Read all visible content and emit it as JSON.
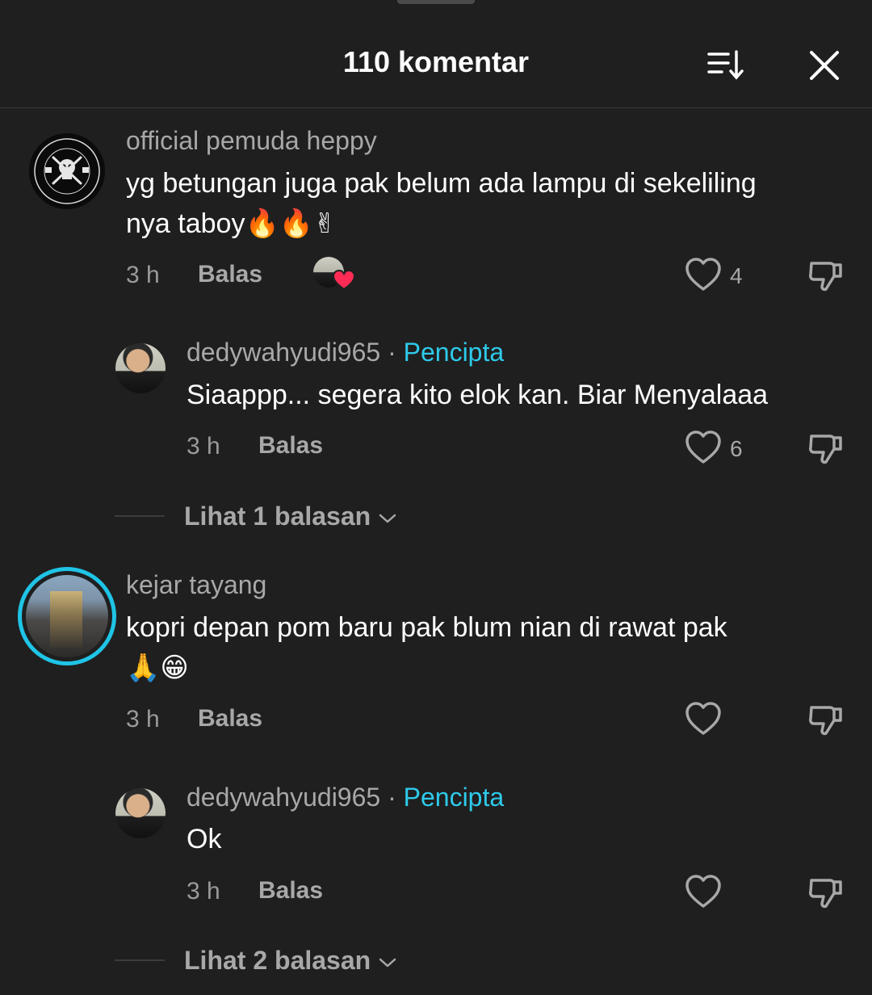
{
  "header": {
    "title": "110 komentar"
  },
  "comments": [
    {
      "username": "official pemuda heppy",
      "text_line1": "yg betungan juga pak belum ada lampu di sekeliling",
      "text_line2": "nya taboy",
      "emojis": "🔥🔥✌",
      "time": "3 h",
      "reply_label": "Balas",
      "like_count": "4",
      "creator_liked": true
    },
    {
      "username": "dedywahyudi965",
      "dot": "·",
      "badge": "Pencipta",
      "text": "Siaappp... segera kito elok kan. Biar Menyalaaa",
      "time": "3 h",
      "reply_label": "Balas",
      "like_count": "6"
    },
    {
      "view_replies": "Lihat 1 balasan"
    },
    {
      "username": "kejar tayang",
      "text_line1": "kopri depan pom baru pak blum nian di rawat pak",
      "emojis": "🙏😁",
      "time": "3 h",
      "reply_label": "Balas",
      "like_count": ""
    },
    {
      "username": "dedywahyudi965",
      "dot": "·",
      "badge": "Pencipta",
      "text": "Ok",
      "time": "3 h",
      "reply_label": "Balas",
      "like_count": ""
    },
    {
      "view_replies": "Lihat 2 balasan"
    }
  ],
  "colors": {
    "background": "#1f1f1f",
    "creator_badge": "#2ecaea",
    "story_ring": "#1fc4e6",
    "heart_badge": "#fe2c55"
  },
  "icons": [
    "sort-icon",
    "close-icon",
    "heart-icon",
    "dislike-icon",
    "chevron-down-icon"
  ]
}
